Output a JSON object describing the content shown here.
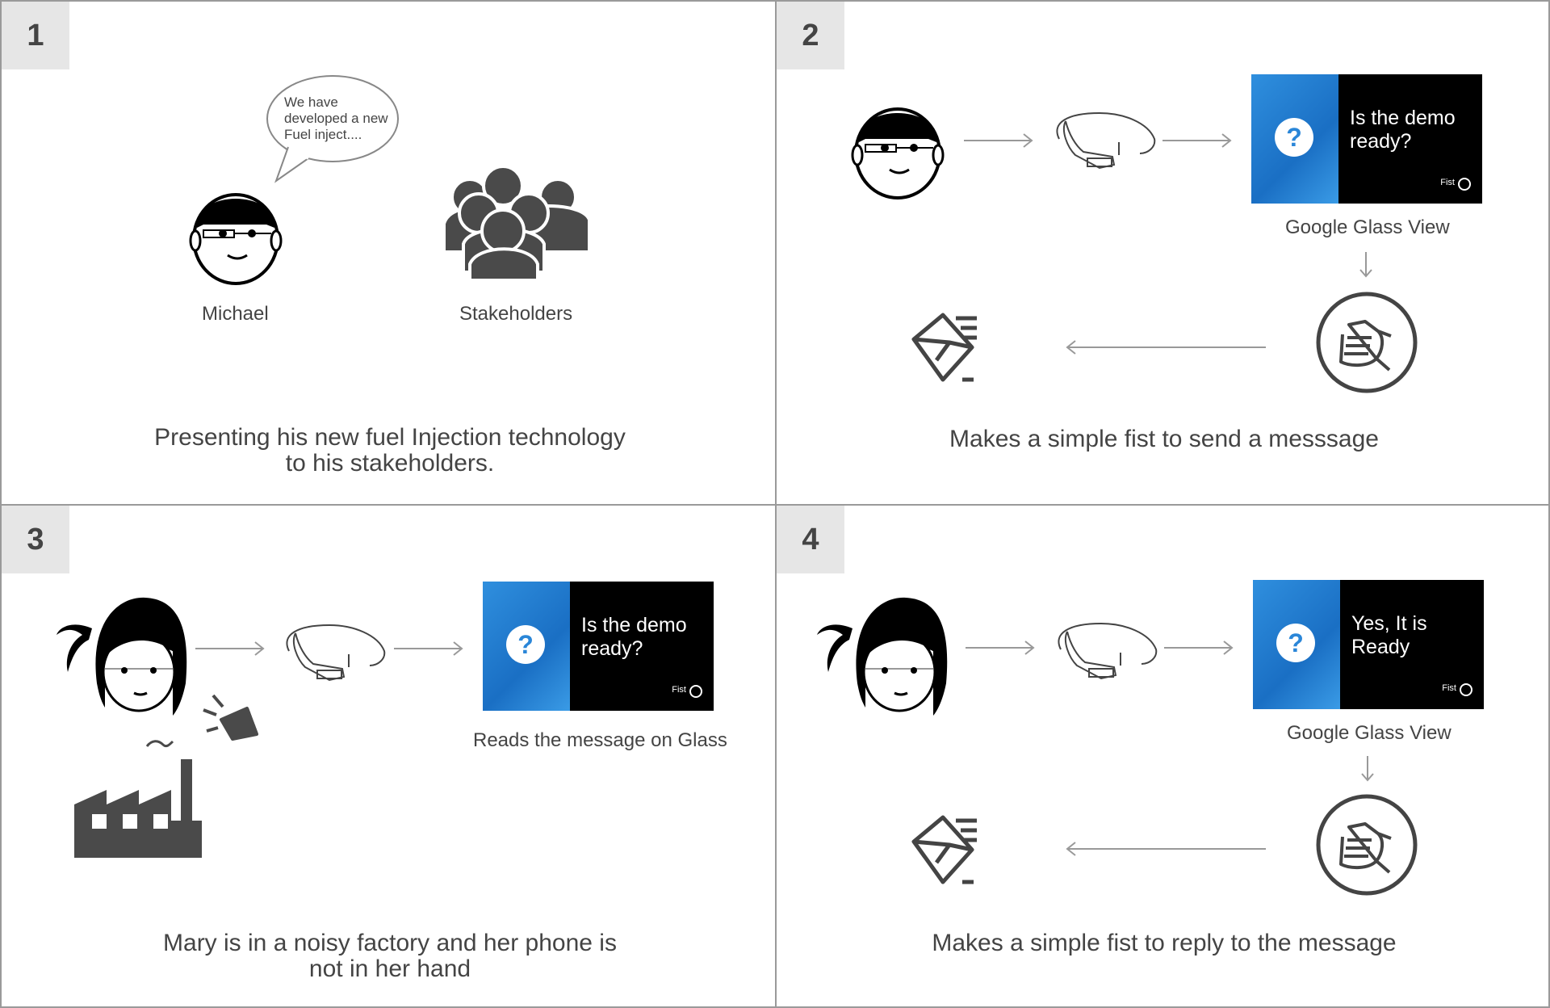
{
  "panels": [
    {
      "number": "1",
      "bubble": [
        "We have",
        "developed a new",
        "Fuel inject...."
      ],
      "person_label": "Michael",
      "group_label": "Stakeholders",
      "caption": [
        "Presenting his new fuel Injection technology",
        "to his stakeholders."
      ]
    },
    {
      "number": "2",
      "glass_text": [
        "Is the demo",
        "ready?"
      ],
      "glass_footer": "Fist",
      "view_label": "Google Glass View",
      "caption": [
        "Makes a simple fist to send a messsage"
      ]
    },
    {
      "number": "3",
      "glass_text": [
        "Is the demo",
        "ready?"
      ],
      "glass_footer": "Fist",
      "view_label": "Reads the message on Glass",
      "caption": [
        "Mary is in a noisy factory and her phone is",
        "not in her hand"
      ]
    },
    {
      "number": "4",
      "glass_text": [
        "Yes, It is",
        "Ready"
      ],
      "glass_footer": "Fist",
      "view_label": "Google Glass View",
      "caption": [
        "Makes a simple fist to reply to the message"
      ]
    }
  ],
  "colors": {
    "icon": "#4a4a4a",
    "glass_blue": "#2a86d8",
    "arrow": "#999999"
  },
  "icons": [
    "boy-with-glass-icon",
    "girl-with-glass-icon",
    "stakeholders-group-icon",
    "google-glass-icon",
    "fist-icon",
    "mail-send-icon",
    "factory-icon",
    "megaphone-icon"
  ]
}
